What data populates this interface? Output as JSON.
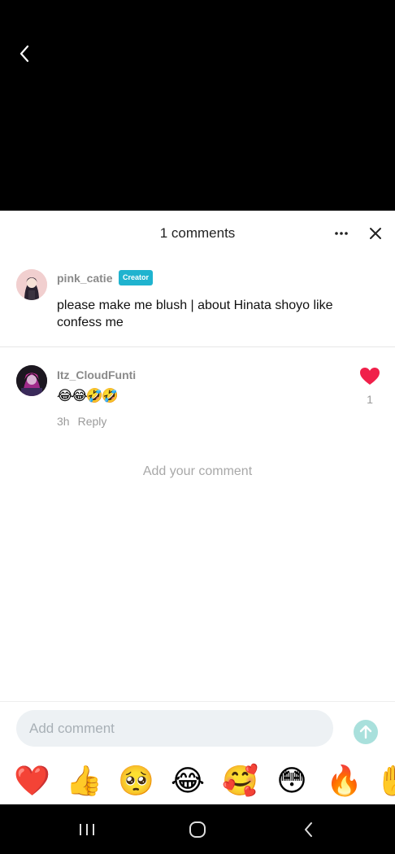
{
  "sheet": {
    "title": "1 comments"
  },
  "original_comment": {
    "username": "pink_catie",
    "badge": "Creator",
    "text": "please make me blush | about Hinata shoyo like confess me"
  },
  "reply_comment": {
    "username": "Itz_CloudFunti",
    "text": "😂😂🤣🤣",
    "time": "3h",
    "reply_label": "Reply",
    "like_count": "1"
  },
  "empty_prompt": "Add your comment",
  "composer": {
    "placeholder": "Add comment"
  },
  "reactions": [
    "❤️",
    "👍",
    "🥺",
    "😂",
    "🥰",
    "😳",
    "🔥",
    "✋"
  ],
  "colors": {
    "badge": "#1fb3cf",
    "like": "#f0204a",
    "send": "#a9e0dc"
  }
}
